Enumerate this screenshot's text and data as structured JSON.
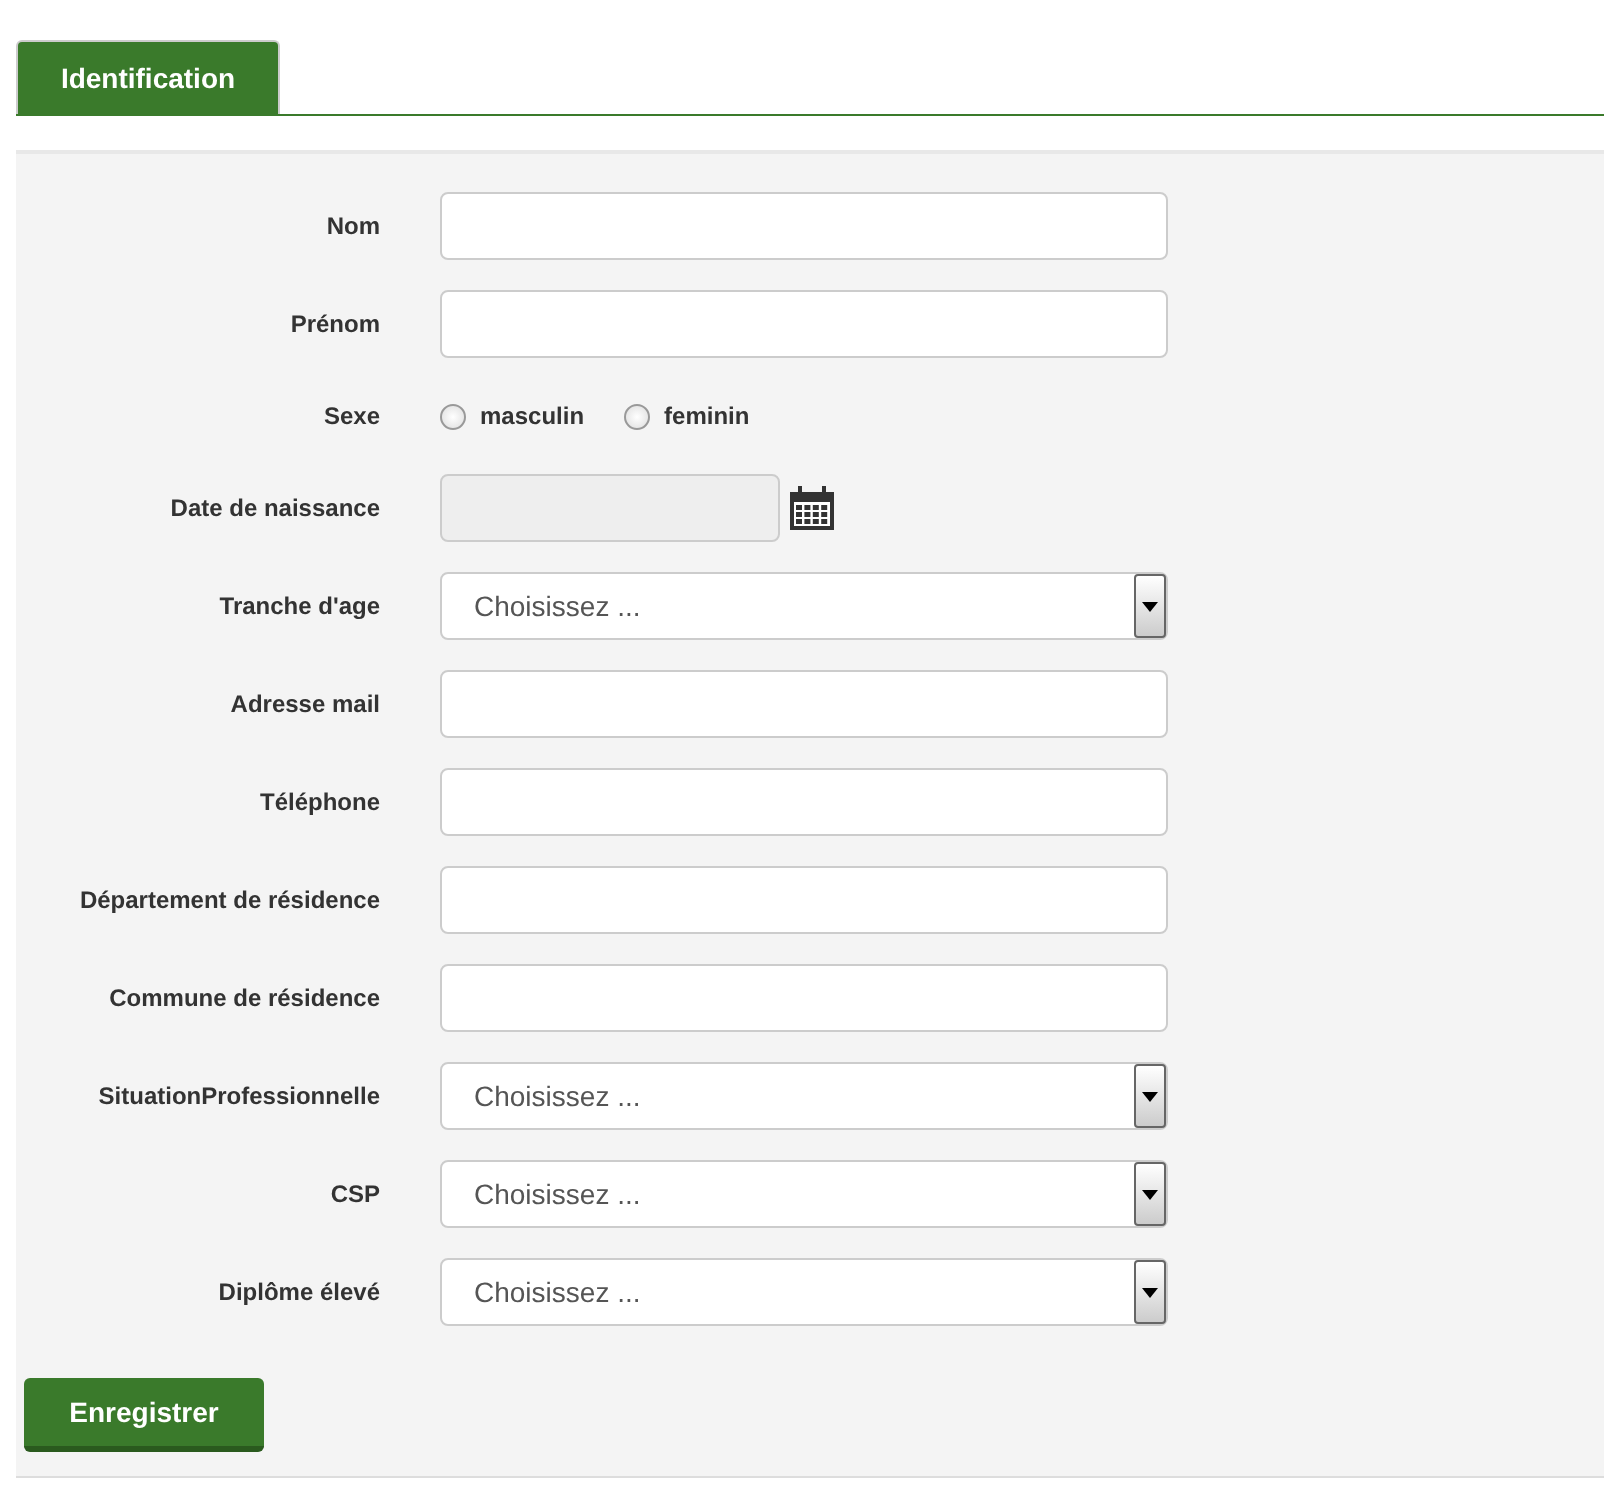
{
  "tabs": [
    {
      "label": "Identification",
      "selected": true
    }
  ],
  "fields": [
    {
      "kind": "text",
      "label": "Nom"
    },
    {
      "kind": "text",
      "label": "Prénom"
    },
    {
      "kind": "radio",
      "label": "Sexe",
      "options": [
        {
          "label": "masculin",
          "selected": false
        },
        {
          "label": "feminin",
          "selected": false
        }
      ]
    },
    {
      "kind": "date",
      "label": "Date de naissance",
      "disabled": true
    },
    {
      "kind": "select",
      "label": "Tranche d'age",
      "value": "Choisissez ..."
    },
    {
      "kind": "text",
      "label": "Adresse mail"
    },
    {
      "kind": "text",
      "label": "Téléphone"
    },
    {
      "kind": "text",
      "label": "Département de résidence"
    },
    {
      "kind": "text",
      "label": "Commune de résidence"
    },
    {
      "kind": "select",
      "label": "SituationProfessionnelle",
      "value": "Choisissez ..."
    },
    {
      "kind": "select",
      "label": "CSP",
      "value": "Choisissez ..."
    },
    {
      "kind": "select",
      "label": "Diplôme élevé",
      "value": "Choisissez ..."
    }
  ],
  "buttons": [
    "Enregistrer"
  ]
}
